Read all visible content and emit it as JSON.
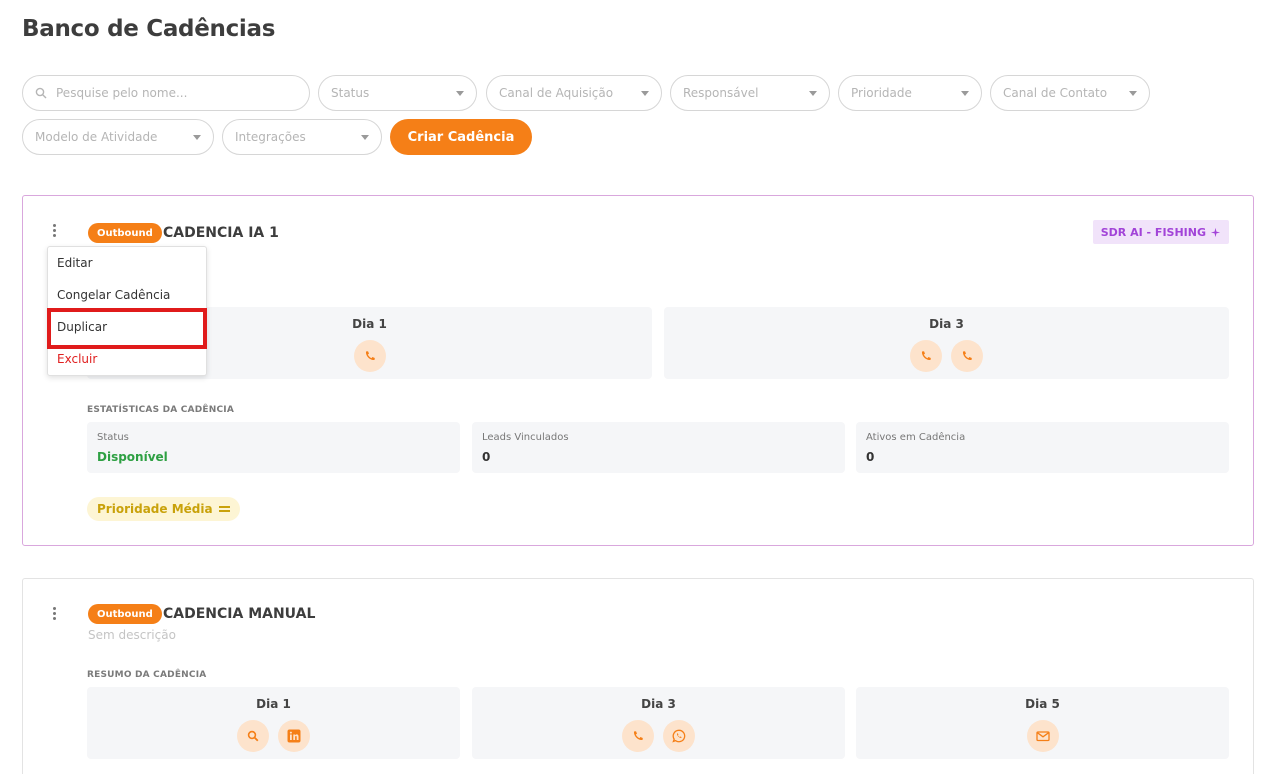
{
  "page": {
    "title": "Banco de Cadências"
  },
  "filters": {
    "search_placeholder": "Pesquise pelo nome...",
    "status": "Status",
    "canal_aquisicao": "Canal de Aquisição",
    "responsavel": "Responsável",
    "prioridade": "Prioridade",
    "canal_contato": "Canal de Contato",
    "modelo_atividade": "Modelo de Atividade",
    "integracoes": "Integrações",
    "create_button": "Criar Cadência"
  },
  "cards": [
    {
      "tag": "Outbound",
      "title": "CADENCIA IA 1",
      "ai_badge": "SDR AI - FISHING",
      "days": [
        {
          "label": "Dia 1",
          "icons": [
            "phone-icon"
          ]
        },
        {
          "label": "Dia 3",
          "icons": [
            "phone-icon",
            "phone-icon"
          ]
        }
      ],
      "stats_label": "ESTATÍSTICAS DA CADÊNCIA",
      "stats": [
        {
          "label": "Status",
          "value": "Disponível"
        },
        {
          "label": "Leads Vinculados",
          "value": "0"
        },
        {
          "label": "Ativos em Cadência",
          "value": "0"
        }
      ],
      "priority": "Prioridade Média"
    },
    {
      "tag": "Outbound",
      "title": "CADENCIA MANUAL",
      "description": "Sem descrição",
      "summary_label": "RESUMO DA CADÊNCIA",
      "days": [
        {
          "label": "Dia 1",
          "icons": [
            "search-icon",
            "linkedin-icon"
          ]
        },
        {
          "label": "Dia 3",
          "icons": [
            "phone-icon",
            "whatsapp-icon"
          ]
        },
        {
          "label": "Dia 5",
          "icons": [
            "mail-icon"
          ]
        }
      ]
    }
  ],
  "context_menu": {
    "items": [
      "Editar",
      "Congelar Cadência",
      "Duplicar",
      "Excluir"
    ]
  },
  "colors": {
    "accent": "#f57f17",
    "icon_bg": "#fde3cc",
    "danger": "#e02020",
    "success": "#2ea043",
    "ai_badge_text": "#a244d8",
    "highlight": "#e01b1b"
  }
}
